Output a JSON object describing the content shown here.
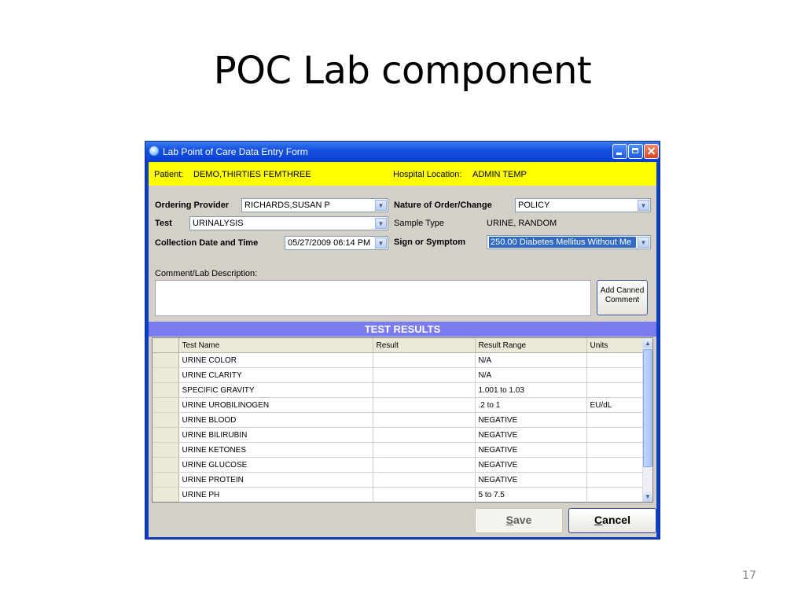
{
  "slide": {
    "title": "POC Lab component",
    "page_number": "17"
  },
  "window": {
    "title": "Lab Point of Care Data Entry Form"
  },
  "patient_bar": {
    "patient_label": "Patient:",
    "patient_value": "DEMO,THIRTIES FEMTHREE",
    "location_label": "Hospital Location:",
    "location_value": "ADMIN TEMP",
    "background": "#ffff00"
  },
  "form": {
    "ordering_provider_label": "Ordering Provider",
    "ordering_provider_value": "RICHARDS,SUSAN P",
    "nature_label": "Nature of Order/Change",
    "nature_value": "POLICY",
    "test_label": "Test",
    "test_value": "URINALYSIS",
    "sample_type_label": "Sample Type",
    "sample_type_value": "URINE, RANDOM",
    "collection_label": "Collection Date and Time",
    "collection_value": "05/27/2009 06:14 PM",
    "sign_label": "Sign or Symptom",
    "sign_value": "250.00 Diabetes Mellitus Without Me",
    "comment_label": "Comment/Lab Description:",
    "comment_value": "",
    "canned_line1": "Add Canned",
    "canned_line2": "Comment"
  },
  "results": {
    "header": "TEST RESULTS",
    "columns": [
      "Test Name",
      "Result",
      "Result Range",
      "Units"
    ],
    "rows": [
      {
        "name": "URINE COLOR",
        "result": "",
        "range": "N/A",
        "units": ""
      },
      {
        "name": "URINE CLARITY",
        "result": "",
        "range": "N/A",
        "units": ""
      },
      {
        "name": "SPECIFIC GRAVITY",
        "result": "",
        "range": "1.001 to 1.03",
        "units": ""
      },
      {
        "name": "URINE UROBILINOGEN",
        "result": "",
        "range": ".2 to 1",
        "units": "EU/dL"
      },
      {
        "name": "URINE BLOOD",
        "result": "",
        "range": "NEGATIVE",
        "units": ""
      },
      {
        "name": "URINE BILIRUBIN",
        "result": "",
        "range": "NEGATIVE",
        "units": ""
      },
      {
        "name": "URINE KETONES",
        "result": "",
        "range": "NEGATIVE",
        "units": ""
      },
      {
        "name": "URINE GLUCOSE",
        "result": "",
        "range": "NEGATIVE",
        "units": ""
      },
      {
        "name": "URINE PROTEIN",
        "result": "",
        "range": "NEGATIVE",
        "units": ""
      },
      {
        "name": "URINE PH",
        "result": "",
        "range": "5 to 7.5",
        "units": ""
      }
    ],
    "header_color": "#7b7bf0"
  },
  "buttons": {
    "save_accel": "S",
    "save_rest": "ave",
    "cancel_accel": "C",
    "cancel_rest": "ancel"
  },
  "icons": {
    "app": "app-globe-icon",
    "minimize": "minimize-icon",
    "maximize": "maximize-icon",
    "close": "close-icon",
    "dropdown": "chevron-down-icon"
  }
}
